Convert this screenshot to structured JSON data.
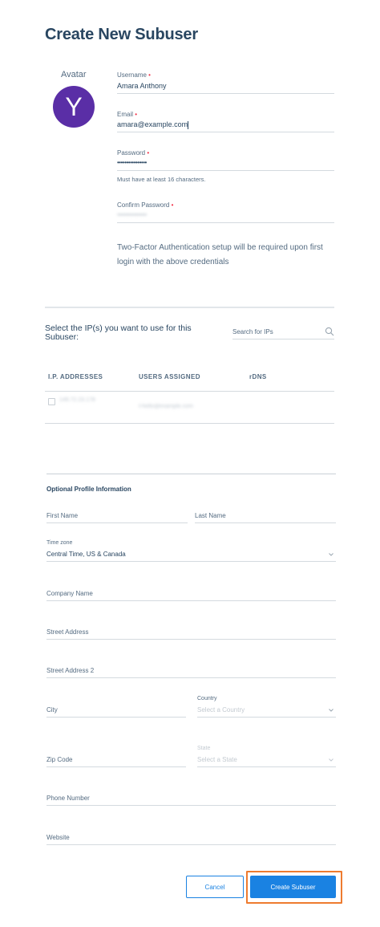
{
  "page": {
    "title": "Create New Subuser"
  },
  "avatar": {
    "label": "Avatar",
    "initial": "Y",
    "color": "#5a2ea6"
  },
  "fields": {
    "username": {
      "label": "Username",
      "required_mark": "•",
      "value": "Amara Anthony"
    },
    "email": {
      "label": "Email",
      "required_mark": "•",
      "value": "amara@example.com"
    },
    "password": {
      "label": "Password",
      "required_mark": "•",
      "value": "••••••••••••••••",
      "hint": "Must have at least 16 characters."
    },
    "confirm_password": {
      "label": "Confirm Password",
      "required_mark": "•",
      "value": "••••••••••••••••"
    }
  },
  "two_factor_notice": "Two-Factor Authentication setup will be required upon first login with the above credentials",
  "ip_section": {
    "prompt": "Select the IP(s) you want to use for this Subuser:",
    "search_placeholder": "Search for IPs",
    "columns": [
      "I.P. ADDRESSES",
      "USERS ASSIGNED",
      "rDNS"
    ],
    "rows": [
      {
        "ip": "149.72.23.178",
        "users": "t-hello@example.com",
        "rdns": ""
      }
    ]
  },
  "profile": {
    "section_title": "Optional Profile Information",
    "first_name": "First Name",
    "last_name": "Last Name",
    "timezone_label": "Time zone",
    "timezone_value": "Central Time, US & Canada",
    "company_name": "Company Name",
    "street_address": "Street Address",
    "street_address_2": "Street Address 2",
    "city": "City",
    "country_label": "Country",
    "country_placeholder": "Select a Country",
    "zip_code": "Zip Code",
    "state_label": "State",
    "state_placeholder": "Select a State",
    "phone_number": "Phone Number",
    "website": "Website"
  },
  "actions": {
    "cancel": "Cancel",
    "create": "Create Subuser"
  },
  "colors": {
    "primary": "#1a82e2",
    "highlight": "#ee7b2f",
    "required": "#f22f46",
    "text": "#294661"
  }
}
